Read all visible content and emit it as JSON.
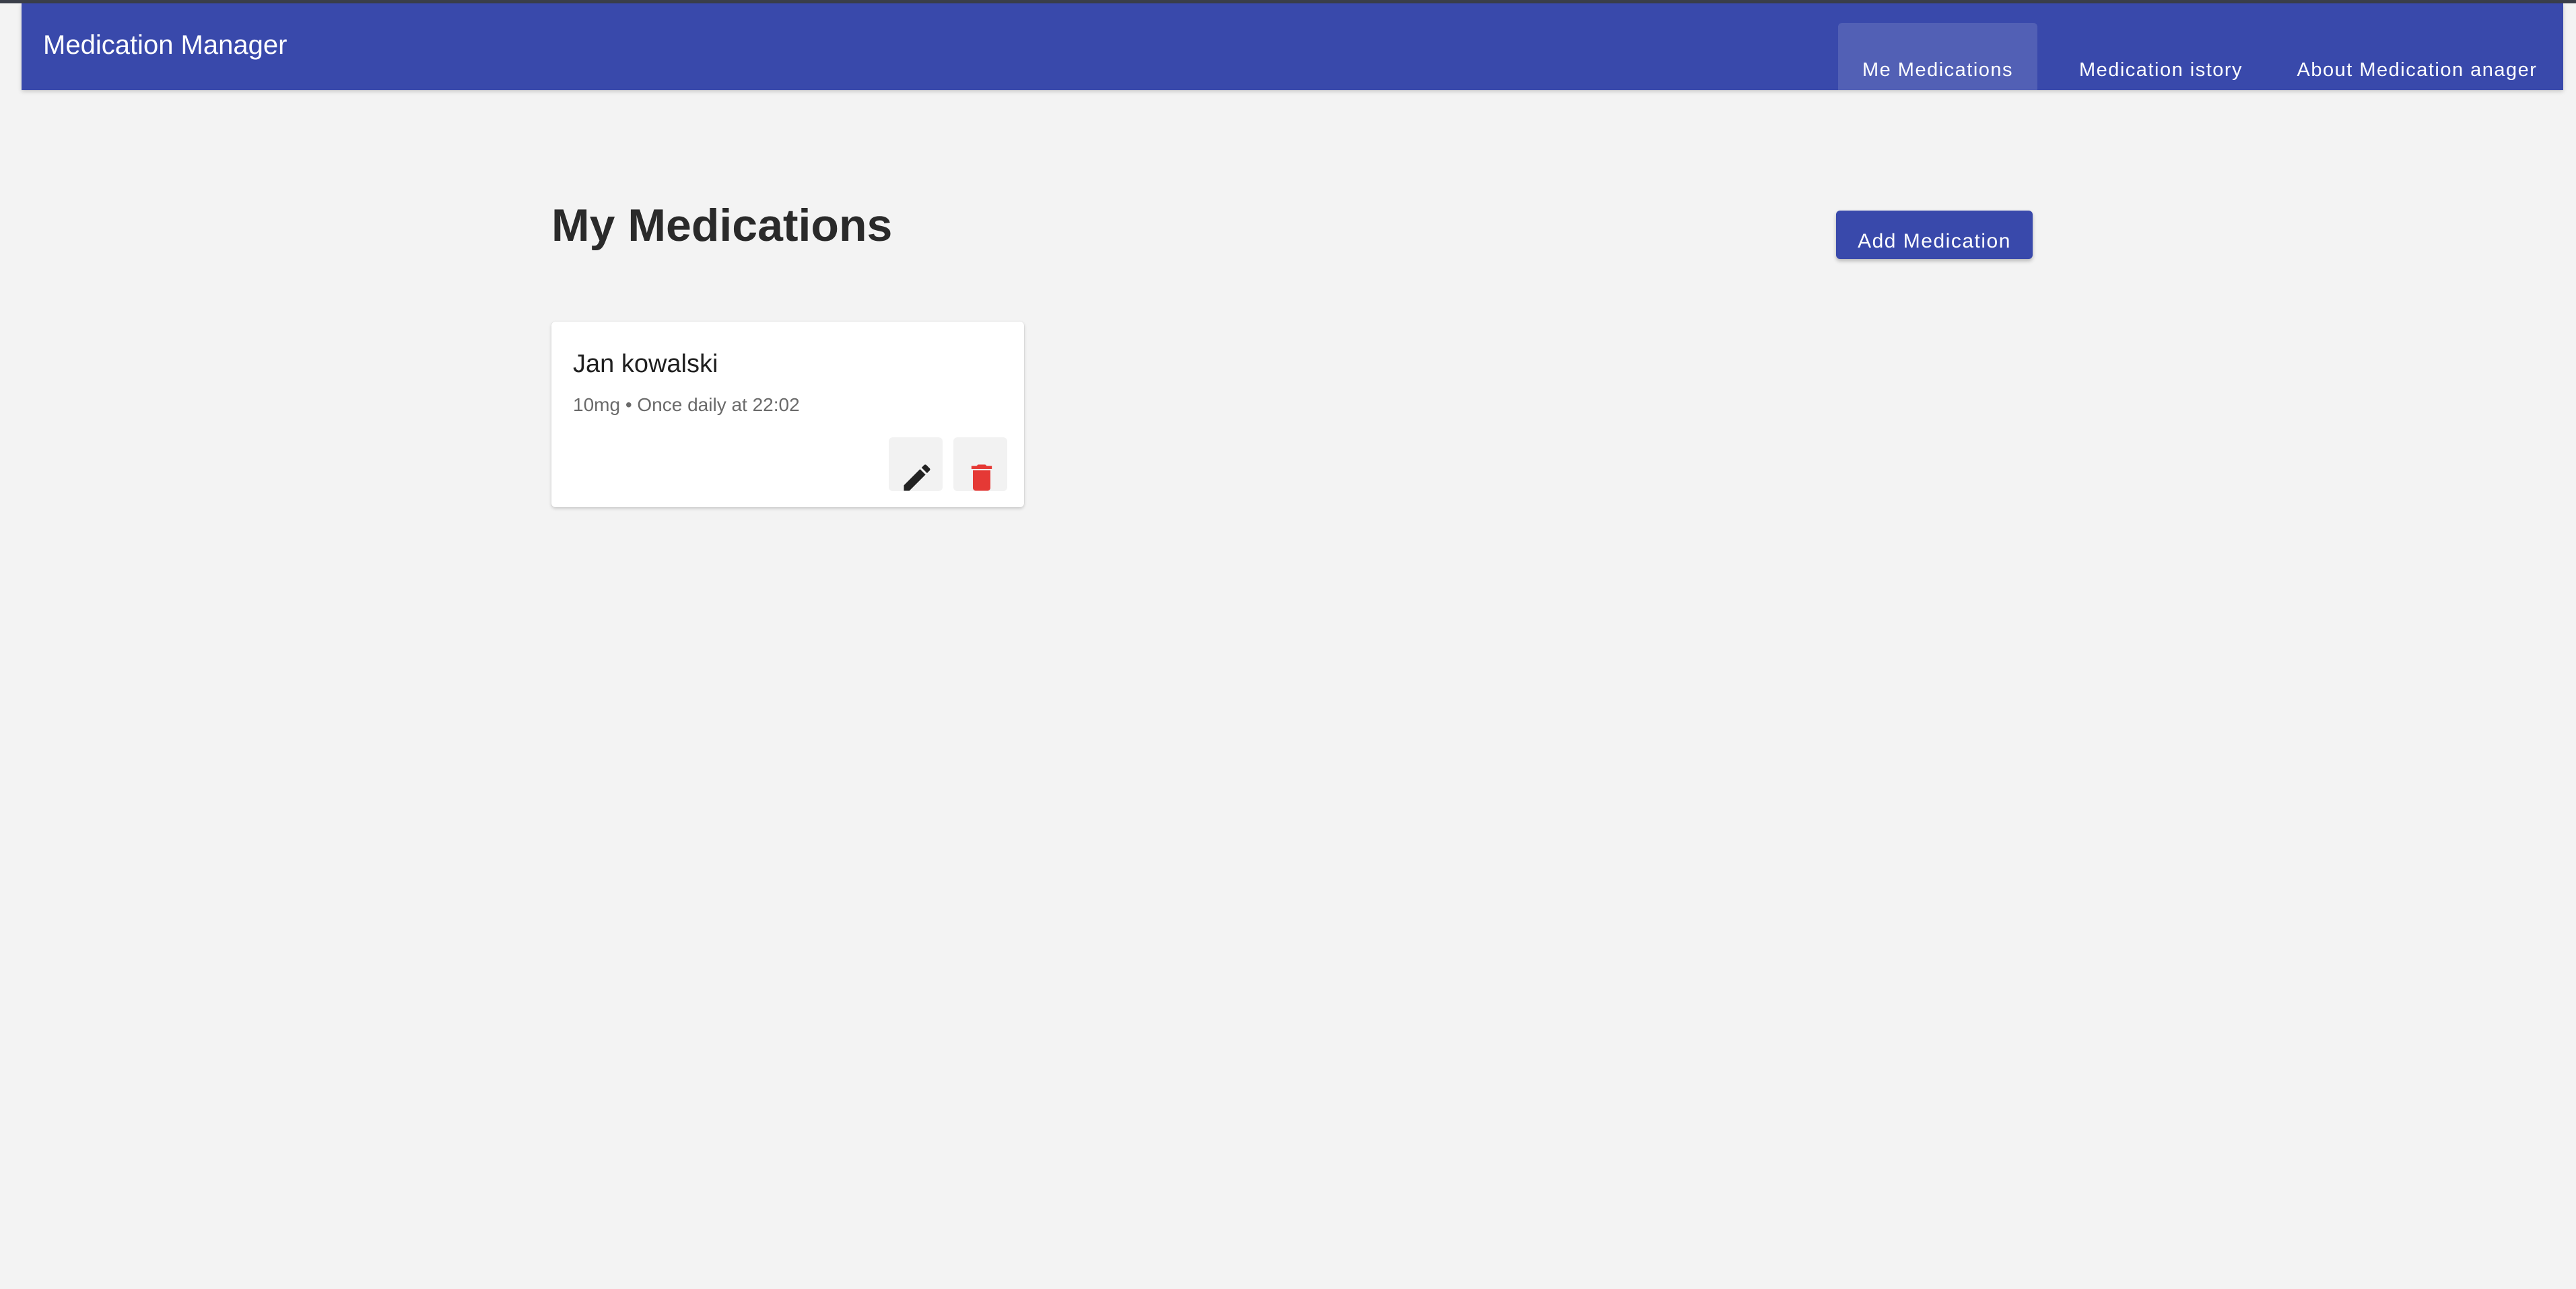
{
  "app": {
    "title": "Medication Manager"
  },
  "nav": {
    "tabs": [
      {
        "label": "Me Medications",
        "active": true
      },
      {
        "label": "Medication istory",
        "active": false
      },
      {
        "label": "About Medication anager",
        "active": false
      }
    ]
  },
  "page": {
    "title": "My Medications",
    "add_button_label": "Add Medication"
  },
  "medications": [
    {
      "name": "Jan kowalski",
      "details": "10mg • Once daily at 22:02",
      "edit_icon": "pencil-icon",
      "delete_icon": "trash-icon"
    }
  ],
  "colors": {
    "primary": "#3949ab",
    "background": "#f3f3f3",
    "delete": "#e53935"
  }
}
